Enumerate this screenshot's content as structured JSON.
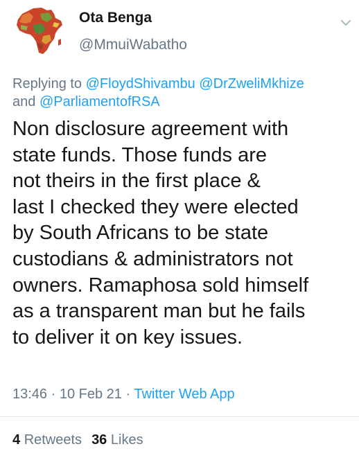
{
  "tweet": {
    "author_name": "Ota Benga",
    "author_handle": "@MmuiWabatho",
    "avatar_icon": "africa-map-icon",
    "reply": {
      "prefix": "Replying to",
      "mention_1": "@FloydShivambu",
      "mention_2": "@DrZweliMkhize",
      "joiner": "and",
      "mention_3": "@ParliamentofRSA"
    },
    "text_lines": [
      "Non disclosure agreement with",
      "state funds. Those funds are",
      "not theirs in the first place &",
      "last I checked they were elected",
      "by South Africans to be state",
      "custodians & administrators not",
      "owners. Ramaphosa sold himself",
      "as  a transparent man but he fails",
      "to deliver it on key issues."
    ],
    "time": "13:46",
    "date": "10 Feb 21",
    "separator": "·",
    "source": "Twitter Web App",
    "retweets_count": "4",
    "retweets_label": "Retweets",
    "likes_count": "36",
    "likes_label": "Likes"
  },
  "colors": {
    "link": "#1da1f2",
    "secondary_text": "#657786",
    "primary_text": "#14171a",
    "divider": "#e1e8ed"
  }
}
